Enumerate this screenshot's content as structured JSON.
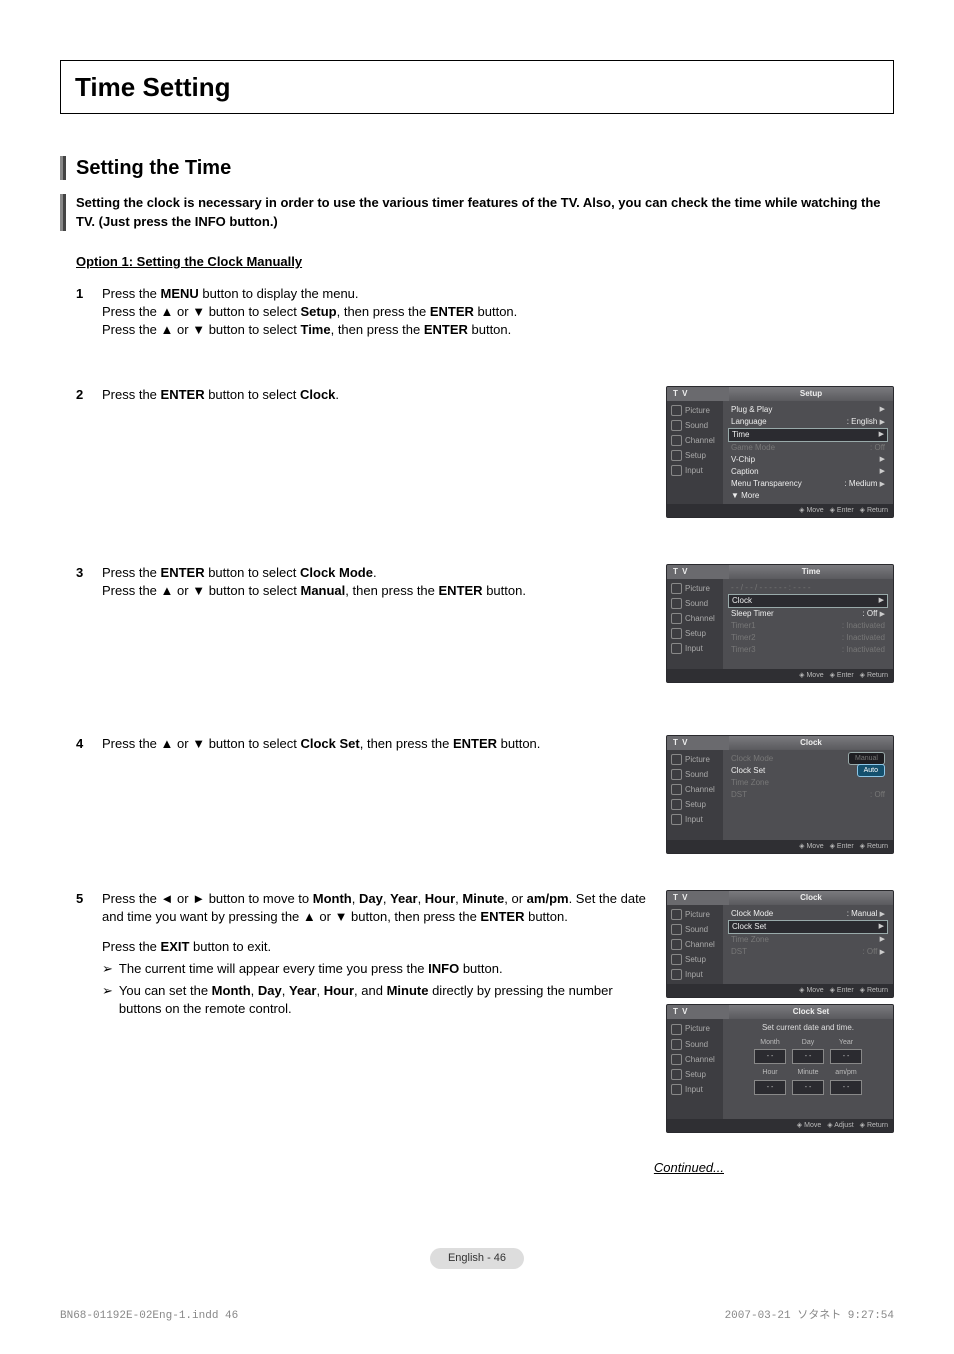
{
  "title": "Time Setting",
  "section": {
    "heading": "Setting the Time",
    "intro": "Setting the clock is necessary in order to use the various timer features of the TV. Also, you can check the time while watching the TV. (Just press the INFO button.)"
  },
  "option_title": "Option 1: Setting the Clock Manually",
  "arrows": {
    "up": "▲",
    "down": "▼",
    "left": "◄",
    "right": "►",
    "note": "➢"
  },
  "steps": {
    "s1": {
      "num": "1",
      "l1a": "Press the ",
      "l1b": "MENU",
      "l1c": " button to display the menu.",
      "l2a": "Press the ",
      "l2b": " or ",
      "l2c": " button to select ",
      "l2d": "Setup",
      "l2e": ", then press the ",
      "l2f": "ENTER",
      "l2g": " button.",
      "l3a": "Press the ",
      "l3b": " or ",
      "l3c": " button to select ",
      "l3d": "Time",
      "l3e": ", then press the ",
      "l3f": "ENTER",
      "l3g": " button."
    },
    "s2": {
      "num": "2",
      "a": "Press the ",
      "b": "ENTER",
      "c": " button to select ",
      "d": "Clock",
      "e": "."
    },
    "s3": {
      "num": "3",
      "l1a": "Press the ",
      "l1b": "ENTER",
      "l1c": " button to select ",
      "l1d": "Clock Mode",
      "l1e": ".",
      "l2a": "Press the ",
      "l2b": " or ",
      "l2c": " button to select ",
      "l2d": "Manual",
      "l2e": ", then press the ",
      "l2f": "ENTER",
      "l2g": " button."
    },
    "s4": {
      "num": "4",
      "a": "Press the ",
      "b": " or ",
      "c": " button to select ",
      "d": "Clock Set",
      "e": ", then press the ",
      "f": "ENTER",
      "g": " button."
    },
    "s5": {
      "num": "5",
      "l1a": "Press the ",
      "l1b": " or ",
      "l1c": " button to move to ",
      "m1": "Month",
      "m2": "Day",
      "m3": "Year",
      "m4": "Hour",
      "m5": "Minute",
      "m6": "am/pm",
      "l1d": ". Set the date and time you want by pressing the ",
      "l1e": " or ",
      "l1f": " button, then press the ",
      "l1g": "ENTER",
      "l1h": " button.",
      "l2a": "Press the ",
      "l2b": "EXIT",
      "l2c": " button to exit.",
      "n1a": "The current time will appear every time you press the ",
      "n1b": "INFO",
      "n1c": " button.",
      "n2a": "You can set the ",
      "n2b": "Month",
      "n2c": ", ",
      "n2d": "Day",
      "n2e": ", ",
      "n2f": "Year",
      "n2g": ", ",
      "n2h": "Hour",
      "n2i": ", and ",
      "n2j": "Minute",
      "n2k": " directly by pressing the number buttons on the remote control."
    }
  },
  "osd_common": {
    "tv": "T V",
    "tabs": [
      "Picture",
      "Sound",
      "Channel",
      "Setup",
      "Input"
    ],
    "move": "Move",
    "enter": "Enter",
    "return": "Return",
    "adjust": "Adjust"
  },
  "osd1": {
    "title": "Setup",
    "rows": {
      "r1": "Plug & Play",
      "r2l": "Language",
      "r2v": ": English",
      "r3": "Time",
      "r4l": "Game Mode",
      "r4v": ": Off",
      "r5": "V-Chip",
      "r6": "Caption",
      "r7l": "Menu Transparency",
      "r7v": ": Medium",
      "r8": "▼ More"
    }
  },
  "osd2": {
    "title": "Time",
    "blank": "- - / - - / - - - -   - - : - -  - -",
    "rows": {
      "r1": "Clock",
      "r2l": "Sleep Timer",
      "r2v": ": Off",
      "r3l": "Timer1",
      "r3v": ": Inactivated",
      "r4l": "Timer2",
      "r4v": ": Inactivated",
      "r5l": "Timer3",
      "r5v": ": Inactivated"
    }
  },
  "osd3": {
    "title": "Clock",
    "rows": {
      "r1": "Clock Mode",
      "p1": "Manual",
      "p2": "Auto",
      "r2": "Clock Set",
      "r3": "Time Zone",
      "r4l": "DST",
      "r4v": ": Off"
    }
  },
  "osd4": {
    "title": "Clock",
    "rows": {
      "r1l": "Clock Mode",
      "r1v": ": Manual",
      "r2": "Clock Set",
      "r3": "Time Zone",
      "r4l": "DST",
      "r4v": ": Off"
    }
  },
  "osd5": {
    "title": "Clock Set",
    "prompt": "Set current date and time.",
    "h1": "Month",
    "h2": "Day",
    "h3": "Year",
    "h4": "Hour",
    "h5": "Minute",
    "h6": "am/pm",
    "cell": "- -"
  },
  "continued": "Continued...",
  "page_label": "English - 46",
  "footer_left": "BN68-01192E-02Eng-1.indd   46",
  "footer_right": "2007-03-21   ソタネト 9:27:54"
}
